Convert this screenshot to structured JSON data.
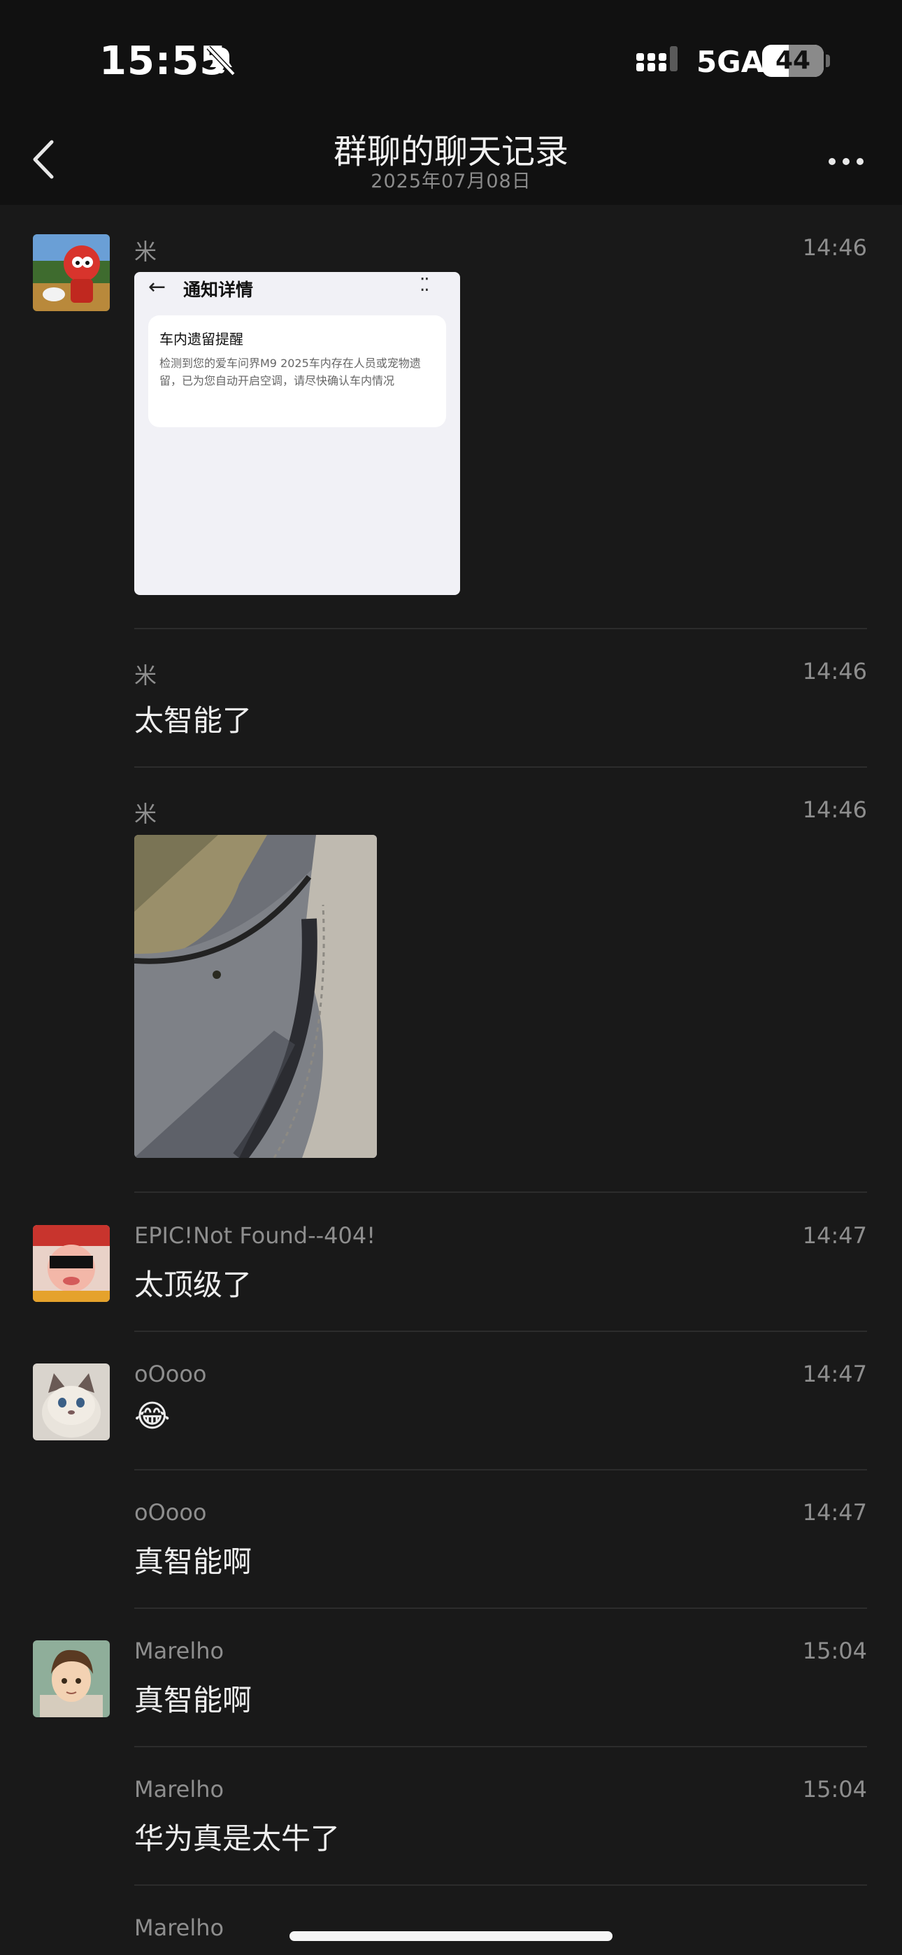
{
  "status_bar": {
    "time": "15:55",
    "network": "5GA",
    "battery": "44"
  },
  "nav": {
    "back_label": "back",
    "title": "群聊的聊天记录",
    "date": "2025年07月08日"
  },
  "notification_card": {
    "header": "通知详情",
    "title": "车内遗留提醒",
    "body": "检测到您的爱车问界M9 2025车内存在人员或宠物遗留，已为您自动开启空调，请尽快确认车内情况"
  },
  "messages": [
    {
      "sender": "米",
      "time": "14:46",
      "type": "image-card"
    },
    {
      "sender": "米",
      "time": "14:46",
      "text": "太智能了"
    },
    {
      "sender": "米",
      "time": "14:46",
      "type": "photo"
    },
    {
      "sender": "EPIC!Not Found--404!",
      "time": "14:47",
      "text": "太顶级了"
    },
    {
      "sender": "oOooo",
      "time": "14:47",
      "text": "😂"
    },
    {
      "sender": "oOooo",
      "time": "14:47",
      "text": "真智能啊"
    },
    {
      "sender": "Marelho",
      "time": "15:04",
      "text": "真智能啊"
    },
    {
      "sender": "Marelho",
      "time": "15:04",
      "text": "华为真是太牛了"
    },
    {
      "sender": "Marelho"
    }
  ],
  "colors": {
    "background": "#191919",
    "bar": "#111111",
    "text": "#eeeeee",
    "meta": "#8e8e8e"
  }
}
